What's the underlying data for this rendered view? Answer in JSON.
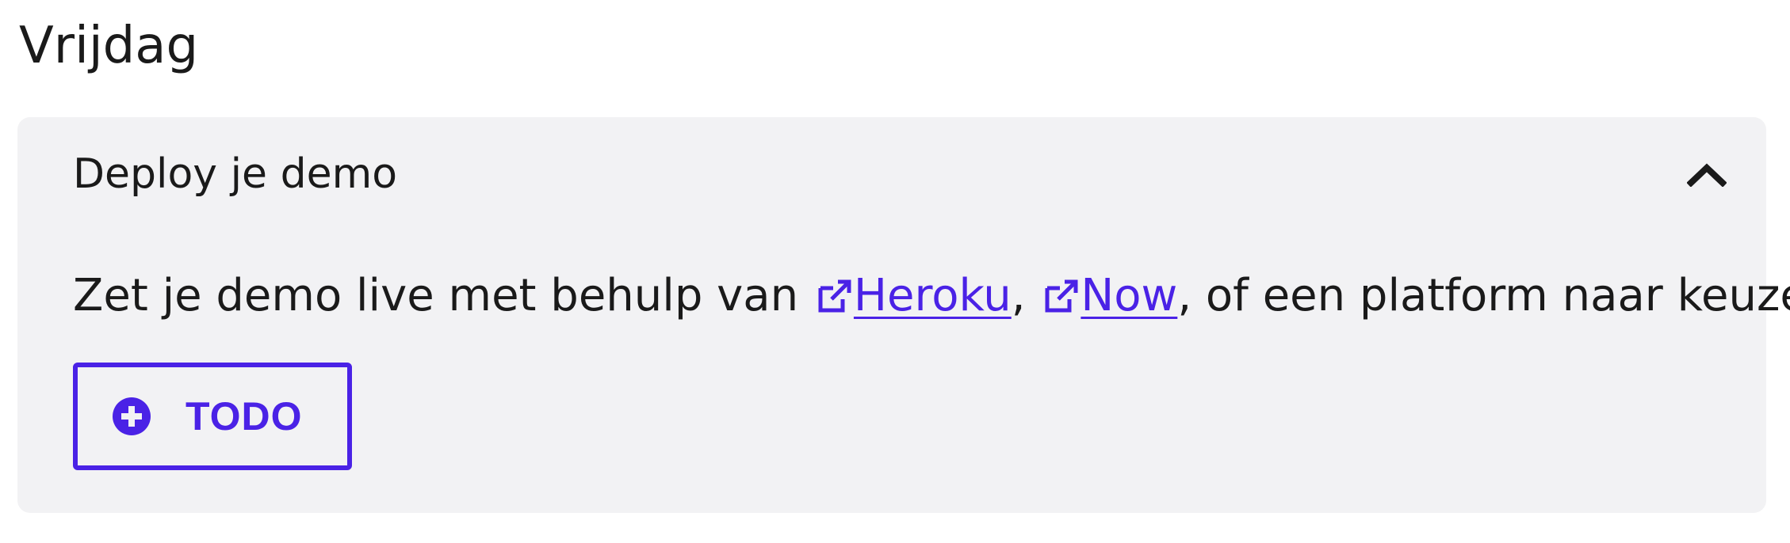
{
  "day": {
    "title": "Vrijdag"
  },
  "panel": {
    "title": "Deploy je demo",
    "expanded": true,
    "toggle_icon": "chevron-up-icon",
    "body": {
      "text_before": "Zet je demo live met behulp van ",
      "links": [
        {
          "label": "Heroku",
          "icon": "external-link-icon"
        },
        {
          "label": "Now",
          "icon": "external-link-icon"
        }
      ],
      "separator": ", ",
      "text_after": ", of een platform naar keuze."
    },
    "todo_button": {
      "label": "TODO",
      "icon": "plus-circle-icon"
    }
  },
  "colors": {
    "accent": "#4a22e6",
    "panel_background": "#f2f2f4",
    "text": "#1a1a1a"
  }
}
